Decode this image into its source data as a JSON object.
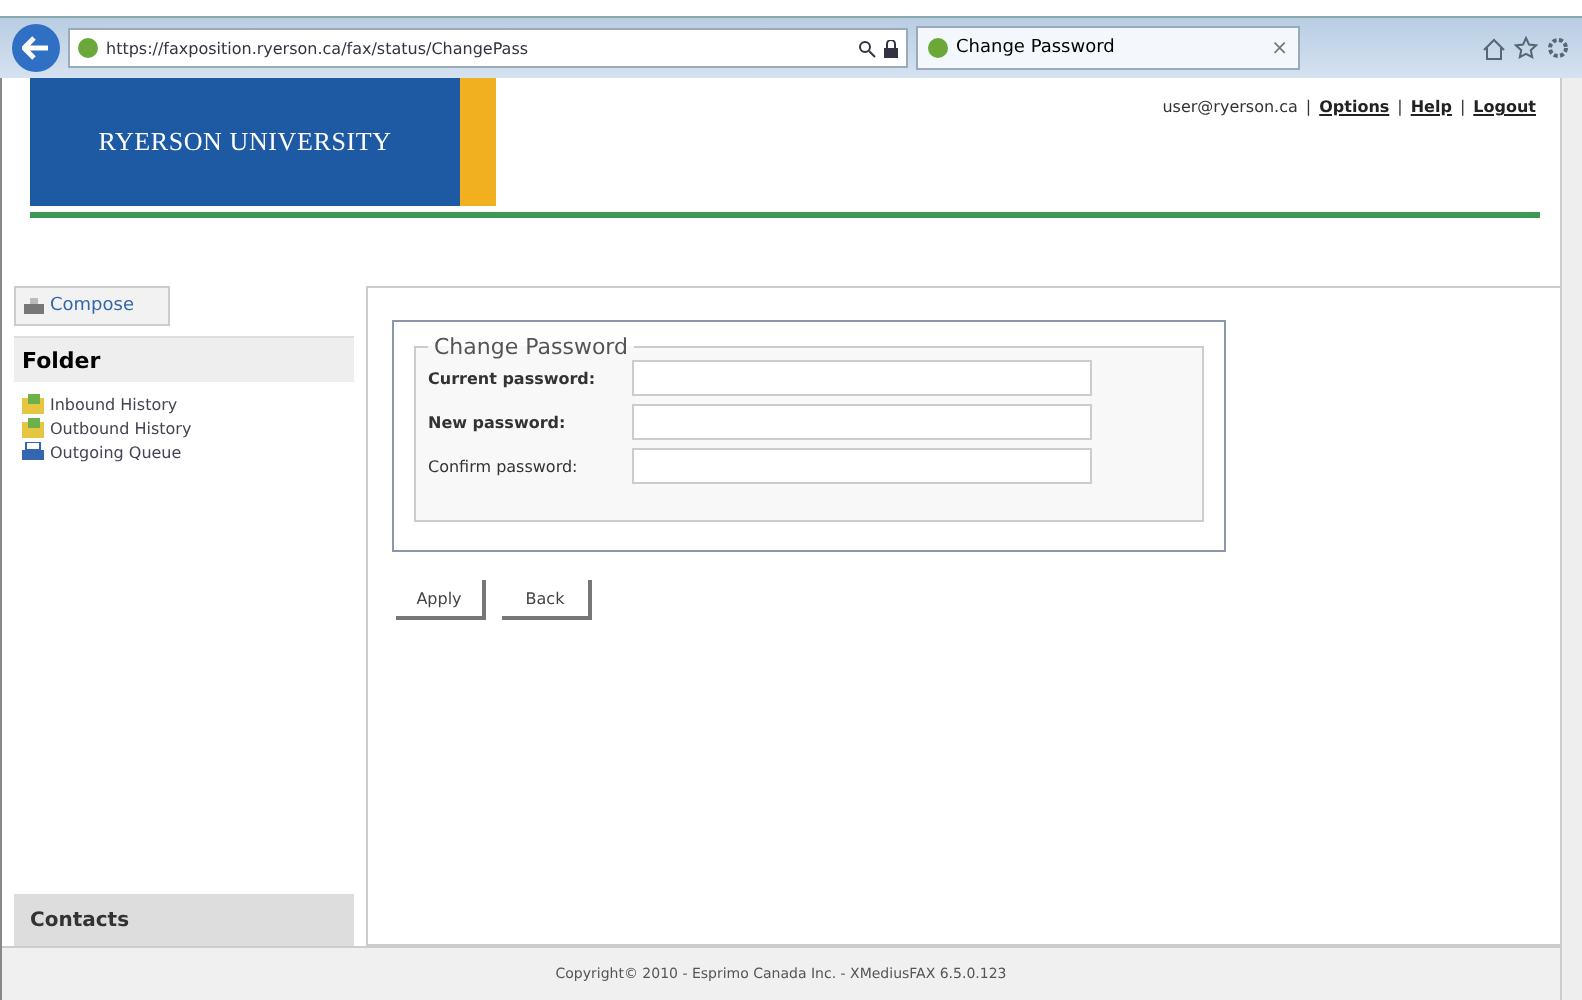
{
  "browser": {
    "url": "https://faxposition.ryerson.ca/fax/status/ChangePass",
    "tab": {
      "title": "Change Password",
      "close": "×"
    }
  },
  "header": {
    "logo": "RYERSON UNIVERSITY",
    "user": "user@ryerson.ca",
    "separator": "|",
    "links": [
      "Options",
      "Help",
      "Logout"
    ]
  },
  "sidebar": {
    "compose": "Compose",
    "folder_title": "Folder",
    "items": [
      {
        "label": "Inbound History",
        "kind": "folder"
      },
      {
        "label": "Outbound History",
        "kind": "folder"
      },
      {
        "label": "Outgoing Queue",
        "kind": "queue"
      }
    ],
    "contacts": "Contacts"
  },
  "form": {
    "legend": "Change Password",
    "fields": [
      {
        "label": "Current password:",
        "bold": true
      },
      {
        "label": "New password:",
        "bold": true
      },
      {
        "label": "Confirm password:",
        "bold": false
      }
    ],
    "buttons": [
      "Apply",
      "Back"
    ]
  },
  "footer": "Copyright© 2010 - Esprimo Canada Inc. - XMediusFAX 6.5.0.123"
}
